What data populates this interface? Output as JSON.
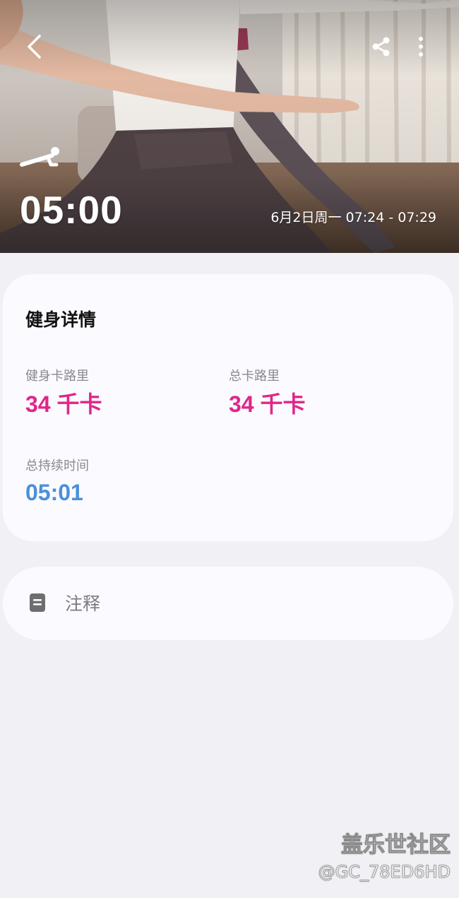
{
  "header": {
    "duration": "05:00",
    "date_range": "6月2日周一 07:24 - 07:29",
    "workout_icon": "plank-icon",
    "back_icon": "chevron-left-icon",
    "share_icon": "share-icon",
    "more_icon": "more-vertical-icon"
  },
  "details": {
    "title": "健身详情",
    "workout_calories": {
      "label": "健身卡路里",
      "value": "34 千卡"
    },
    "total_calories": {
      "label": "总卡路里",
      "value": "34 千卡"
    },
    "total_duration": {
      "label": "总持续时间",
      "value": "05:01"
    }
  },
  "notes": {
    "label": "注释",
    "icon": "note-icon"
  },
  "watermark": {
    "title": "盖乐世社区",
    "user": "@GC_78ED6HD"
  },
  "colors": {
    "calorie_accent": "#e0268a",
    "time_accent": "#4a90d9",
    "background": "#f1f0f5",
    "card": "#fbfaff"
  }
}
